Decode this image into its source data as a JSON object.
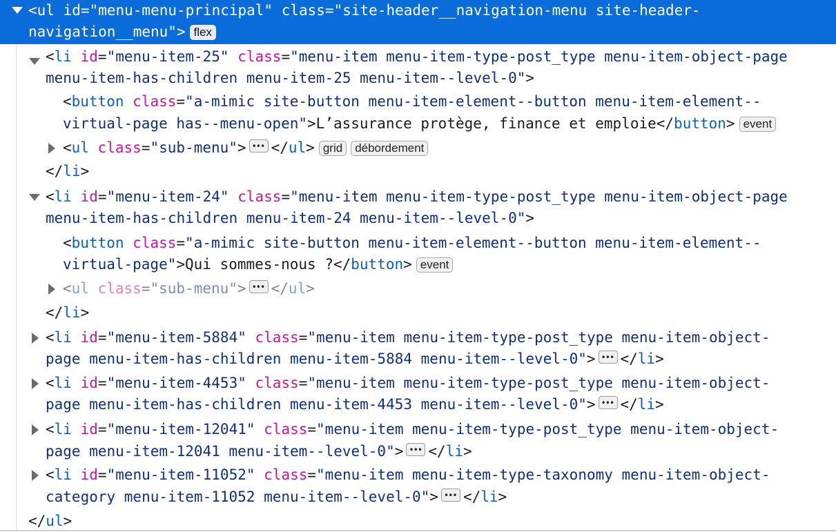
{
  "nodes": {
    "ul_main": {
      "line1": {
        "open": "<",
        "tag": "ul",
        "a1": "id",
        "v1": "\"menu-menu-principal\"",
        "a2": "class",
        "v2": "\"site-header__navigation-menu site-header-"
      },
      "line2": {
        "v": "navigation__menu\"",
        "close": ">"
      },
      "badge": "flex"
    },
    "li25": {
      "line1": {
        "tag": "li",
        "a1": "id",
        "v1": "\"menu-item-25\"",
        "a2": "class",
        "v2": "\"menu-item menu-item-type-post_type menu-item-object-page"
      },
      "line2": {
        "v": "menu-item-has-children menu-item-25 menu-item--level-0\""
      }
    },
    "btn25": {
      "line1": {
        "tag": "button",
        "a1": "class",
        "v1": "\"a-mimic site-button menu-item-element--button menu-item-element--"
      },
      "line2": {
        "v": "virtual-page has--menu-open\"",
        "text": "L’assurance protège, finance et emploie",
        "ctag": "button"
      },
      "badge": "event"
    },
    "ul25": {
      "tag": "ul",
      "a1": "class",
      "v1": "\"sub-menu\"",
      "ctag": "ul",
      "badge1": "grid",
      "badge2": "débordement"
    },
    "li25_close": {
      "tag": "li"
    },
    "li24": {
      "line1": {
        "tag": "li",
        "a1": "id",
        "v1": "\"menu-item-24\"",
        "a2": "class",
        "v2": "\"menu-item menu-item-type-post_type menu-item-object-page"
      },
      "line2": {
        "v": "menu-item-has-children menu-item-24 menu-item--level-0\""
      }
    },
    "btn24": {
      "line1": {
        "tag": "button",
        "a1": "class",
        "v1": "\"a-mimic site-button menu-item-element--button menu-item-element--"
      },
      "line2": {
        "v": "virtual-page\"",
        "text": "Qui sommes-nous ?",
        "ctag": "button"
      },
      "badge": "event"
    },
    "ul24": {
      "tag": "ul",
      "a1": "class",
      "v1": "\"sub-menu\"",
      "ctag": "ul"
    },
    "li24_close": {
      "tag": "li"
    },
    "li5884": {
      "line1": {
        "tag": "li",
        "a1": "id",
        "v1": "\"menu-item-5884\"",
        "a2": "class",
        "v2": "\"menu-item menu-item-type-post_type menu-item-object-"
      },
      "line2": {
        "v": "page menu-item-has-children menu-item-5884 menu-item--level-0\"",
        "ctag": "li"
      }
    },
    "li4453": {
      "line1": {
        "tag": "li",
        "a1": "id",
        "v1": "\"menu-item-4453\"",
        "a2": "class",
        "v2": "\"menu-item menu-item-type-post_type menu-item-object-"
      },
      "line2": {
        "v": "page menu-item-has-children menu-item-4453 menu-item--level-0\"",
        "ctag": "li"
      }
    },
    "li12041": {
      "line1": {
        "tag": "li",
        "a1": "id",
        "v1": "\"menu-item-12041\"",
        "a2": "class",
        "v2": "\"menu-item menu-item-type-post_type menu-item-object-"
      },
      "line2": {
        "v": "page menu-item-12041 menu-item--level-0\"",
        "ctag": "li"
      }
    },
    "li11052": {
      "line1": {
        "tag": "li",
        "a1": "id",
        "v1": "\"menu-item-11052\"",
        "a2": "class",
        "v2": "\"menu-item menu-item-type-taxonomy menu-item-object-"
      },
      "line2": {
        "v": "category menu-item-11052 menu-item--level-0\"",
        "ctag": "li"
      }
    },
    "ul_close": {
      "tag": "ul"
    }
  }
}
